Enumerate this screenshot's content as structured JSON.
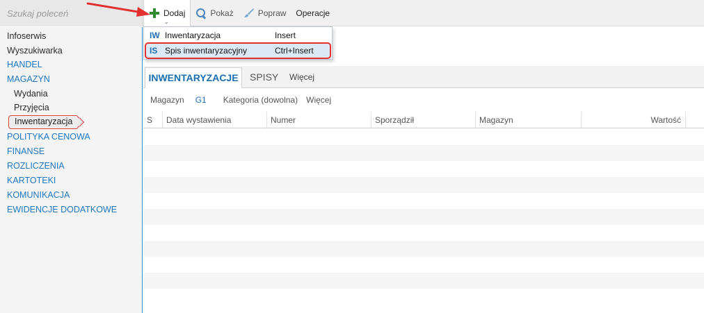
{
  "search": {
    "placeholder": "Szukaj poleceń"
  },
  "toolbar": {
    "add_label": "Dodaj",
    "show_label": "Pokaż",
    "edit_label": "Popraw",
    "operations_label": "Operacje",
    "caret": "⌄"
  },
  "dropdown": {
    "items": [
      {
        "abbr": "IW",
        "label": "Inwentaryzacja",
        "shortcut": "Insert"
      },
      {
        "abbr": "IS",
        "label": "Spis inwentaryzacyjny",
        "shortcut": "Ctrl+Insert"
      }
    ]
  },
  "sidebar": {
    "items": [
      {
        "label": "Infoserwis"
      },
      {
        "label": "Wyszukiwarka"
      },
      {
        "label": "HANDEL"
      },
      {
        "label": "MAGAZYN"
      },
      {
        "label": "Wydania"
      },
      {
        "label": "Przyjęcia"
      },
      {
        "label": "Inwentaryzacja"
      },
      {
        "label": "POLITYKA CENOWA"
      },
      {
        "label": "FINANSE"
      },
      {
        "label": "ROZLICZENIA"
      },
      {
        "label": "KARTOTEKI"
      },
      {
        "label": "KOMUNIKACJA"
      },
      {
        "label": "EWIDENCJE DODATKOWE"
      }
    ]
  },
  "tabs": [
    {
      "label": "INWENTARYZACJE"
    },
    {
      "label": "SPISY"
    },
    {
      "label": "Więcej"
    }
  ],
  "filters": {
    "warehouse_label": "Magazyn",
    "warehouse_value": "G1",
    "category": "Kategoria (dowolna)",
    "more": "Więcej"
  },
  "table": {
    "columns": [
      "S",
      "Data wystawienia",
      "Numer",
      "Sporządził",
      "Magazyn",
      "Wartość"
    ]
  },
  "colors": {
    "accent": "#1e78c2",
    "annotation": "#e53030",
    "add_icon": "#2e8b2e"
  }
}
